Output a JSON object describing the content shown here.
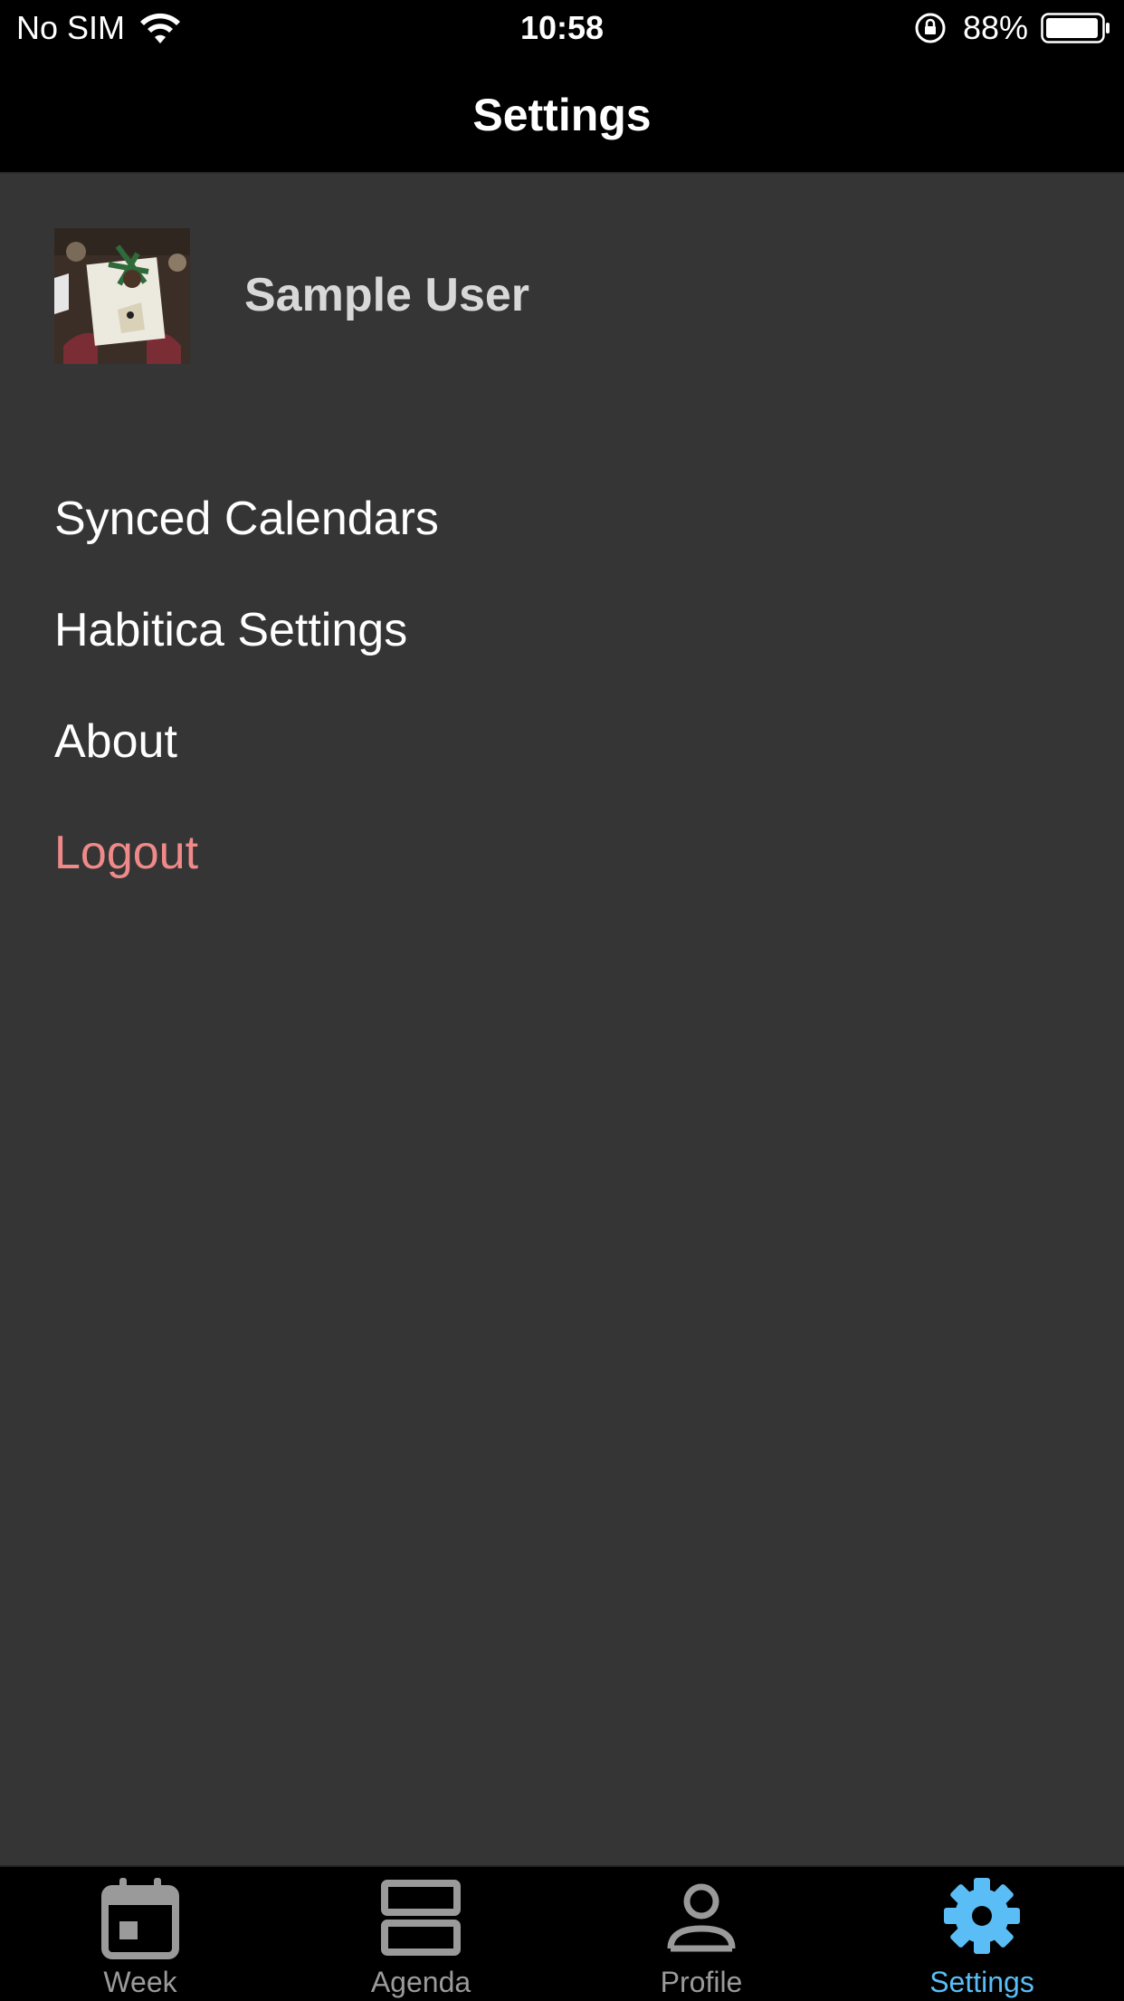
{
  "status_bar": {
    "carrier": "No SIM",
    "time": "10:58",
    "battery": "88%"
  },
  "header": {
    "title": "Settings"
  },
  "profile": {
    "name": "Sample User",
    "avatar_icon": "gift-photo-avatar"
  },
  "menu": {
    "items": [
      {
        "label": "Synced Calendars"
      },
      {
        "label": "Habitica Settings"
      },
      {
        "label": "About"
      },
      {
        "label": "Logout"
      }
    ]
  },
  "tabs": [
    {
      "label": "Week",
      "icon": "calendar-icon"
    },
    {
      "label": "Agenda",
      "icon": "agenda-icon"
    },
    {
      "label": "Profile",
      "icon": "person-icon"
    },
    {
      "label": "Settings",
      "icon": "gear-icon",
      "active": true
    }
  ],
  "colors": {
    "background": "#353535",
    "bars": "#000000",
    "logout": "#f08a8a",
    "active_tab": "#5bbdf5",
    "inactive_tab": "#9a9a9a"
  }
}
